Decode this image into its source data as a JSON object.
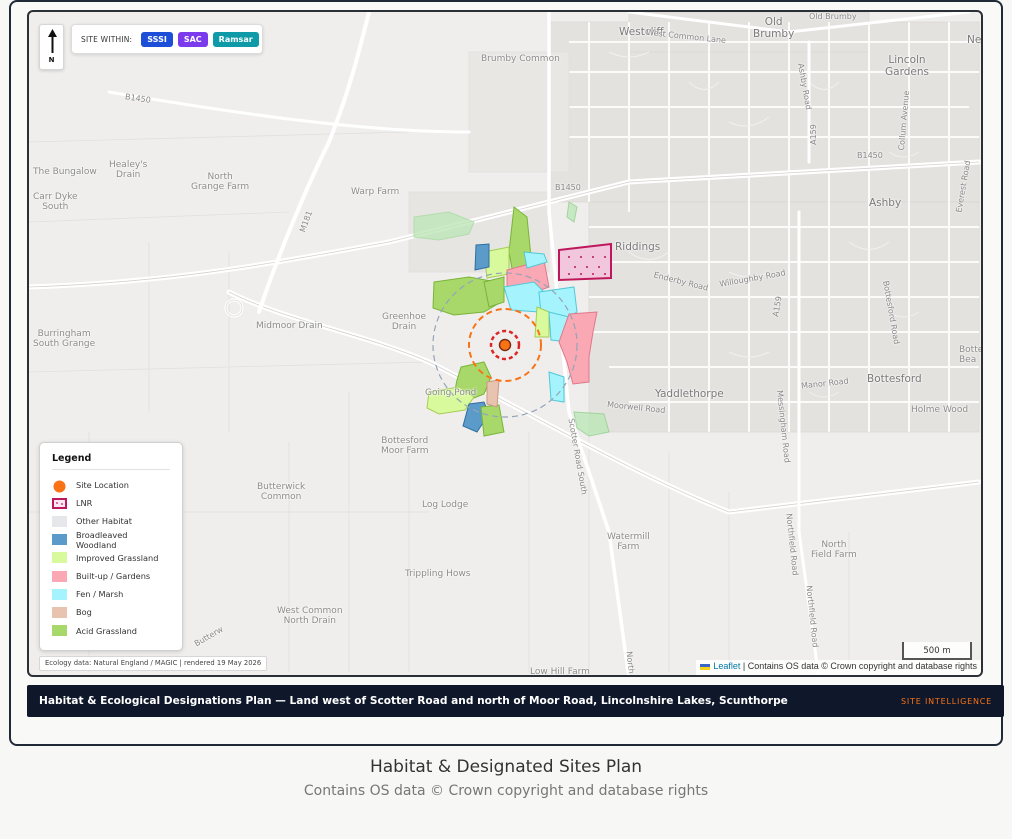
{
  "map": {
    "site_within_label": "SITE WITHIN:",
    "designations": [
      {
        "label": "SSSI",
        "color": "#1d4ed8"
      },
      {
        "label": "SAC",
        "color": "#7c3aed"
      },
      {
        "label": "Ramsar",
        "color": "#0e9aa7"
      }
    ],
    "north_letter": "N",
    "place_labels": {
      "westcliff": "Westcliff",
      "old_brumby": "Old\nBrumby",
      "lincoln_gardens": "Lincoln\nGardens",
      "ne": "Ne",
      "brumby_common": "Brumby Common",
      "the_bungalow": "The Bungalow",
      "healeys_drain": "Healey's\nDrain",
      "north_grange_farm": "North\nGrange Farm",
      "carr_dyke_south": "Carr Dyke\nSouth",
      "warp_farm": "Warp Farm",
      "riddings": "Riddings",
      "ashby": "Ashby",
      "burringham_south_grange": "Burringham\nSouth Grange",
      "midmoor_drain": "Midmoor Drain",
      "greenhoe_drain": "Greenhoe\nDrain",
      "bottesford": "Bottesford",
      "yaddlethorpe": "Yaddlethorpe",
      "holme_wood": "Holme Wood",
      "bottesford_moor_farm": "Bottesford\nMoor Farm",
      "butterwick_common": "Butterwick\nCommon",
      "log_lodge": "Log Lodge",
      "watermill_farm": "Watermill\nFarm",
      "north_field_farm": "North\nField Farm",
      "trippling_hows": "Trippling Hows",
      "west_common_north_drain": "West Common\nNorth Drain",
      "low_hill_farm": "Low Hill Farm",
      "going_pond": "Going Pond",
      "bottesford_right": "Botte\nBea"
    },
    "road_labels": {
      "b1450_a": "B1450",
      "b1450_b": "B1450",
      "b1450_c": "B1450",
      "west_common_lane": "West Common Lane",
      "old_brumby_st": "Old Brumby",
      "ashby_road": "Ashby Road",
      "a159": "A159",
      "collum_avenue": "Collum Avenue",
      "everest_road": "Everest Road",
      "m181": "M181",
      "enderby_road": "Enderby Road",
      "willoughby_road": "Willoughby Road",
      "a159b": "A159",
      "bottesford_road": "Bottesford Road",
      "manor_road": "Manor Road",
      "moorwell_road": "Moorwell Road",
      "scotter_road_south": "Scotter Road South",
      "messingham_road": "Messingham Road",
      "northfield_road": "Northfield Road",
      "northfield_road2": "Northfield Road",
      "butterwick": "Butterw",
      "north": "North"
    },
    "legend": {
      "title": "Legend",
      "items": [
        {
          "label": "Site Location",
          "kind": "dot",
          "color": "#f97316"
        },
        {
          "label": "LNR",
          "kind": "lnr",
          "color": "#be185d"
        },
        {
          "label": "Other Habitat",
          "kind": "box",
          "color": "#e5e7eb"
        },
        {
          "label": "Broadleaved Woodland",
          "kind": "box",
          "color": "#5b9bc9"
        },
        {
          "label": "Improved Grassland",
          "kind": "box",
          "color": "#d9f99d"
        },
        {
          "label": "Built-up / Gardens",
          "kind": "box",
          "color": "#f9a8b4"
        },
        {
          "label": "Fen / Marsh",
          "kind": "box",
          "color": "#a5f3fc"
        },
        {
          "label": "Bog",
          "kind": "box",
          "color": "#e8c3b0"
        },
        {
          "label": "Acid Grassland",
          "kind": "box",
          "color": "#a8d86a"
        }
      ]
    },
    "data_credit": "Ecology data: Natural England / MAGIC | rendered 19 May 2026",
    "scale_label": "500 m",
    "attribution_link": "Leaflet",
    "attribution_text": "| Contains OS data © Crown copyright and database rights"
  },
  "footer": {
    "title": "Habitat & Ecological Designations Plan — Land west of Scotter Road and north of Moor Road, Lincolnshire Lakes, Scunthorpe",
    "brand": "SITE INTELLIGENCE"
  },
  "caption": {
    "title": "Habitat & Designated Sites Plan",
    "subtitle": "Contains OS data © Crown copyright and database rights"
  }
}
